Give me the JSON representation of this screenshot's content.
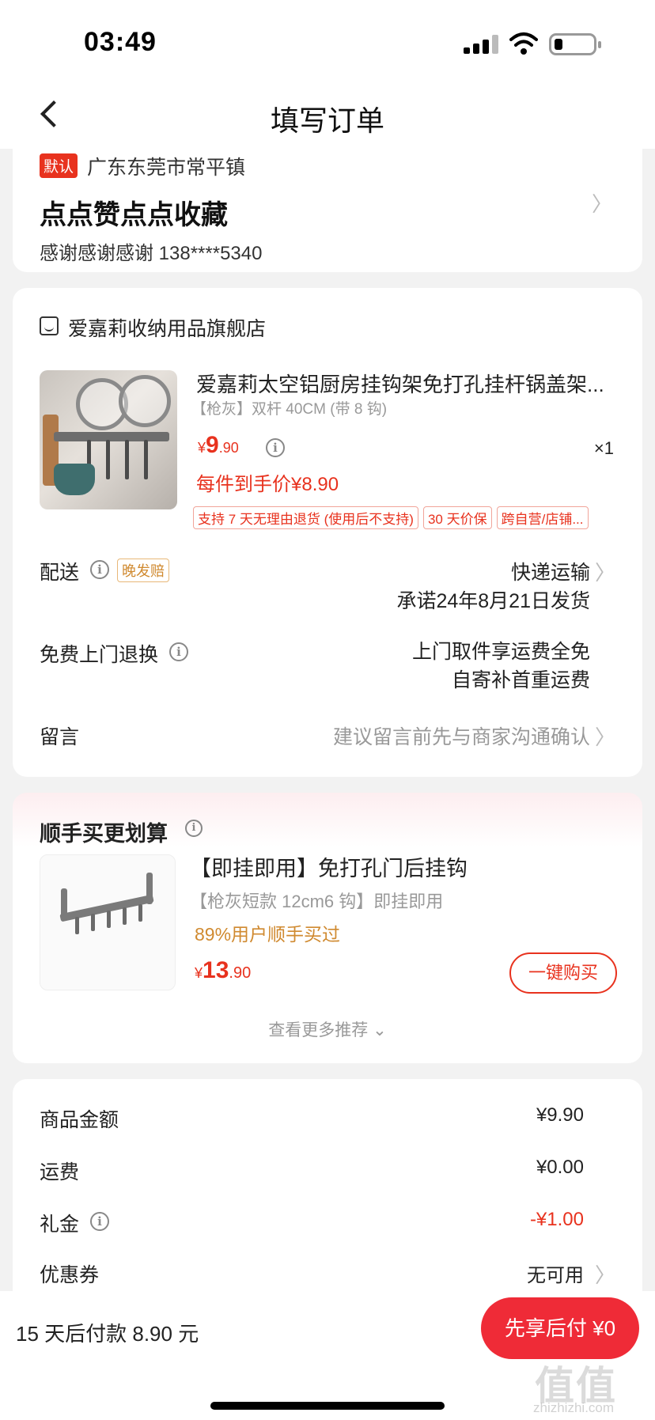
{
  "status": {
    "time": "03:49"
  },
  "nav": {
    "title": "填写订单"
  },
  "address": {
    "badge": "默认",
    "region": "广东东莞市常平镇",
    "detail": "点点赞点点收藏",
    "contact": "感谢感谢感谢   138****5340"
  },
  "order": {
    "shop_name": "爱嘉莉收纳用品旗舰店",
    "product_title": "爱嘉莉太空铝厨房挂钩架免打孔挂杆锅盖架...",
    "product_spec": "【枪灰】双杆 40CM (带 8 钩)",
    "price_currency": "¥",
    "price_int": "9",
    "price_dec": ".90",
    "quantity": "×1",
    "final_price": "每件到手价¥8.90",
    "tags": [
      "支持 7 天无理由退货 (使用后不支持)",
      "30 天价保",
      "跨自营/店铺..."
    ],
    "delivery_label": "配送",
    "late_badge": "晚发赔",
    "delivery_method": "快递运输",
    "delivery_promise": "承诺24年8月21日发货",
    "return_label": "免费上门退换",
    "return_line1": "上门取件享运费全免",
    "return_line2": "自寄补首重运费",
    "message_label": "留言",
    "message_placeholder": "建议留言前先与商家沟通确认"
  },
  "recommend": {
    "title": "顺手买更划算",
    "name": "【即挂即用】免打孔门后挂钩",
    "spec": "【枪灰短款 12cm6 钩】即挂即用",
    "bought": "89%用户顺手买过",
    "price_currency": "¥",
    "price_int": "13",
    "price_dec": ".90",
    "buy_label": "一键购买",
    "more_label": "查看更多推荐 ⌄"
  },
  "summary": {
    "rows": [
      {
        "label": "商品金额",
        "value": "¥9.90"
      },
      {
        "label": "运费",
        "value": "¥0.00"
      },
      {
        "label": "礼金",
        "value": "-¥1.00"
      },
      {
        "label": "优惠券",
        "value": "无可用"
      }
    ]
  },
  "footer": {
    "pay_later": "15 天后付款 8.90 元",
    "checkout_label": "先享后付 ¥0",
    "watermark": "值值值",
    "watermark_sub": "zhizhizhi.com"
  },
  "colors": {
    "accent": "#e8321e",
    "button": "#ef2b37",
    "orange": "#d08a30"
  }
}
